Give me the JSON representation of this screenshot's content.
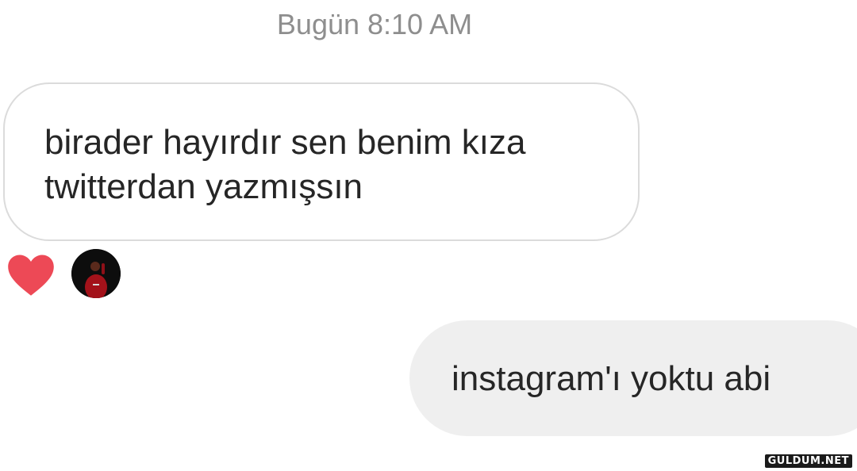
{
  "chat": {
    "timestamp": "Bugün 8:10 AM",
    "messages": [
      {
        "direction": "incoming",
        "lines": [
          "birader hayırdır sen benim kıza",
          "twitterdan yazmışsın"
        ]
      },
      {
        "direction": "outgoing",
        "text": "instagram'ı yoktu abi"
      }
    ],
    "reaction": {
      "icon": "heart-icon",
      "color": "#ed4956"
    },
    "colors": {
      "incoming_border": "#dbdbdb",
      "outgoing_bg": "#efefef",
      "text": "#262626",
      "timestamp": "#8e8e8e"
    }
  },
  "watermark": {
    "text": "GULDUM.NET"
  }
}
